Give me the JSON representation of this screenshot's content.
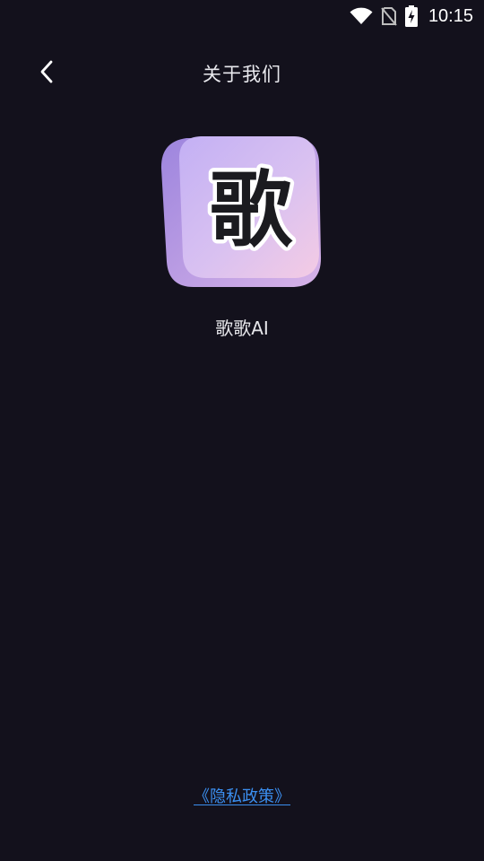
{
  "status_bar": {
    "time": "10:15",
    "icons": [
      "wifi-icon",
      "no-sim-icon",
      "battery-charging-icon"
    ]
  },
  "header": {
    "back_icon": "chevron-left-icon",
    "title": "关于我们"
  },
  "app": {
    "logo_glyph": "歌",
    "name": "歌歌AI"
  },
  "footer": {
    "privacy_link": "《隐私政策》"
  },
  "colors": {
    "background": "#13111c",
    "link": "#3b8ff0",
    "logo_gradient_start": "#c6b3f5",
    "logo_gradient_end": "#f1c6e6"
  }
}
